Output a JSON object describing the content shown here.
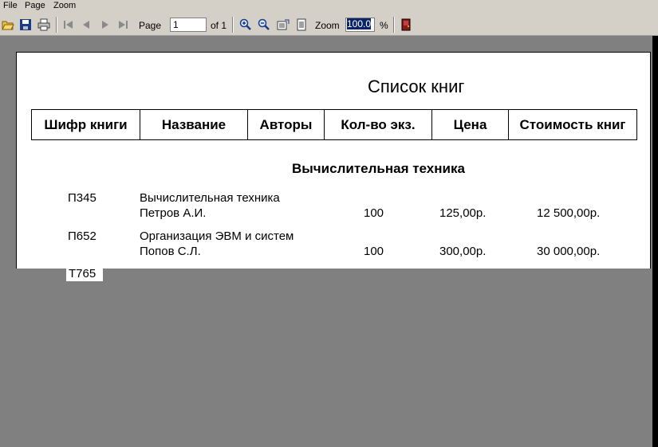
{
  "menu": {
    "file": "File",
    "page": "Page",
    "zoom": "Zoom"
  },
  "toolbar": {
    "page_label": "Page",
    "page_value": "1",
    "page_of": "of 1",
    "zoom_label": "Zoom",
    "zoom_value": "100.0",
    "percent": "%"
  },
  "report": {
    "title": "Список книг",
    "columns": [
      "Шифр книги",
      "Название",
      "Авторы",
      "Кол-во экз.",
      "Цена",
      "Стоимость книг"
    ],
    "section": "Вычислительная техника",
    "rows": [
      {
        "code": "П345",
        "title": "Вычислительная техника",
        "author": "Петров А.И.",
        "qty": "100",
        "price": "125,00р.",
        "total": "12 500,00р."
      },
      {
        "code": "П652",
        "title": "Организация ЭВМ и систем",
        "author": "Попов С.Л.",
        "qty": "100",
        "price": "300,00р.",
        "total": "30 000,00р."
      }
    ],
    "partial_code": "Т765"
  }
}
